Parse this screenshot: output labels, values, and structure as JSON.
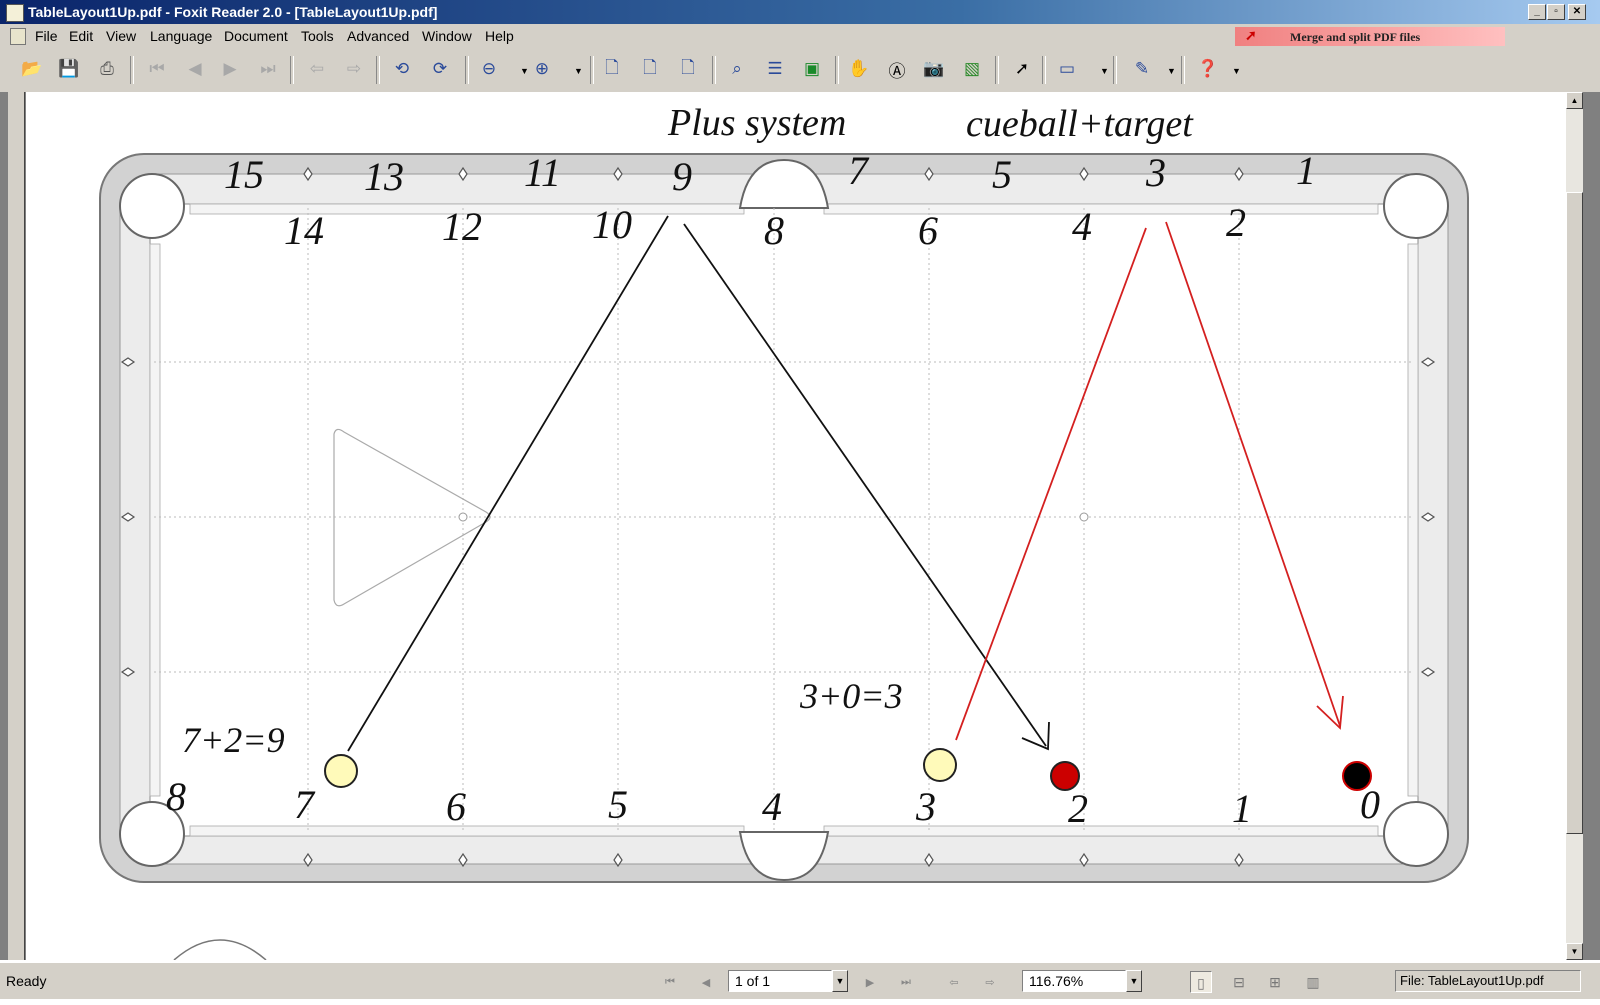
{
  "window": {
    "title": "TableLayout1Up.pdf - Foxit Reader 2.0 - [TableLayout1Up.pdf]"
  },
  "menu": [
    "File",
    "Edit",
    "View",
    "Language",
    "Document",
    "Tools",
    "Advanced",
    "Window",
    "Help"
  ],
  "ad_banner": "Merge and split PDF files",
  "document": {
    "header_left": "Plus system",
    "header_right": "cueball+target",
    "top_outer": [
      "15",
      "13",
      "11",
      "9",
      "7",
      "5",
      "3",
      "1"
    ],
    "top_inner": [
      "14",
      "12",
      "10",
      "8",
      "6",
      "4",
      "2"
    ],
    "bottom": [
      "8",
      "7",
      "6",
      "5",
      "4",
      "3",
      "2",
      "1",
      "0"
    ],
    "formula_left": "7+2=9",
    "formula_right": "3+0=3"
  },
  "status": {
    "text": "Ready",
    "page": "1 of 1",
    "zoom": "116.76%",
    "file": "File: TableLayout1Up.pdf"
  },
  "colors": {
    "title_gradient_start": "#0a246a",
    "chrome": "#d4d0c8",
    "red_line": "#d42020",
    "cueball": "#fffaba",
    "target_red": "#cc0000",
    "target_black": "#000000"
  }
}
